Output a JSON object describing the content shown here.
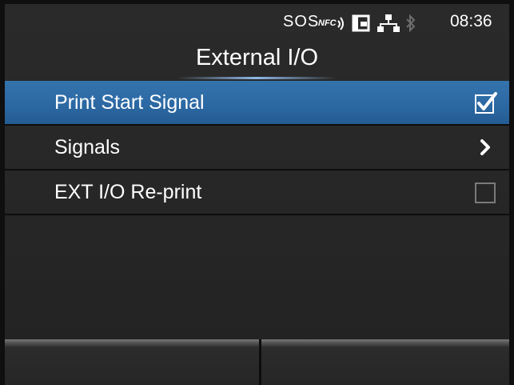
{
  "status_bar": {
    "sos_label": "SOS",
    "nfc_label": "NFC",
    "icons": [
      "nfc-icon",
      "sd-card-icon",
      "network-icon",
      "bluetooth-icon"
    ],
    "time": "08:36"
  },
  "header": {
    "title": "External I/O"
  },
  "menu": {
    "items": [
      {
        "label": "Print Start Signal",
        "accessory": "checkbox",
        "checked": true,
        "selected": true
      },
      {
        "label": "Signals",
        "accessory": "chevron-right",
        "selected": false
      },
      {
        "label": "EXT I/O Re-print",
        "accessory": "checkbox",
        "checked": false,
        "selected": false
      }
    ]
  },
  "softkeys": {
    "left_label": "",
    "right_label": ""
  },
  "colors": {
    "selection": "#2d6aa5",
    "background": "#262626",
    "separator": "#0d0d0d",
    "text": "#ffffff",
    "disabled_icon": "#7a7a7a"
  }
}
